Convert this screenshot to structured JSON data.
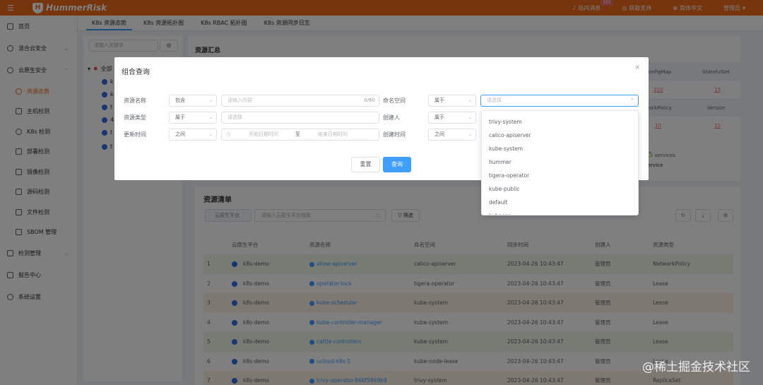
{
  "topbar": {
    "logo": "HummerRisk",
    "messages": "站内消息",
    "messages_badge": "155",
    "support": "获取支持",
    "language": "简体中文",
    "user": "管理员"
  },
  "sidebar": {
    "items": [
      {
        "label": "首页"
      },
      {
        "label": "混合云安全"
      },
      {
        "label": "云原生安全"
      }
    ],
    "subitems": [
      {
        "label": "资源态势"
      },
      {
        "label": "主机检测"
      },
      {
        "label": "K8s 检测"
      },
      {
        "label": "部署检测"
      },
      {
        "label": "镜像检测"
      },
      {
        "label": "源码检测"
      },
      {
        "label": "文件检测"
      },
      {
        "label": "SBOM 管理"
      }
    ],
    "bottom": [
      {
        "label": "检测管理"
      },
      {
        "label": "报告中心"
      },
      {
        "label": "系统设置"
      }
    ]
  },
  "tabs": [
    "K8s 资源态势",
    "K8s 资源拓扑图",
    "K8s RBAC 拓扑图",
    "K8s 资源同步日志"
  ],
  "tree": {
    "search_placeholder": "请输入关键字",
    "root": "全部",
    "nodes": [
      "k",
      "k",
      "t",
      "4",
      "t",
      "t"
    ]
  },
  "summary": {
    "title": "资源汇总",
    "headers": [
      "onfigMap",
      "StatefulSet",
      "tworkPolicy",
      "Version"
    ],
    "values": [
      "310",
      "15",
      "10",
      "10"
    ],
    "services_count": "5",
    "services_label": "services",
    "service_word": "ervice"
  },
  "list": {
    "title": "资源清单",
    "platform_filter": "云原生平台",
    "search_placeholder": "请输入云原生平台搜索",
    "filter_label": "筛选",
    "columns": [
      "",
      "云原生平台",
      "资源名称",
      "命名空间",
      "同步时间",
      "创建人",
      "资源类型"
    ],
    "rows": [
      {
        "idx": "1",
        "platform": "k8s-demo",
        "name": "allow-apiserver",
        "ns": "calico-apiserver",
        "time": "2023-04-26 10:43:47",
        "creator": "管理员",
        "type": "NetworkPolicy",
        "tone": "g"
      },
      {
        "idx": "2",
        "platform": "k8s-demo",
        "name": "operator-lock",
        "ns": "tigera-operator",
        "time": "2023-04-26 10:43:47",
        "creator": "管理员",
        "type": "Lease",
        "tone": ""
      },
      {
        "idx": "3",
        "platform": "k8s-demo",
        "name": "kube-scheduler",
        "ns": "kube-system",
        "time": "2023-04-26 10:43:47",
        "creator": "管理员",
        "type": "Lease",
        "tone": "o"
      },
      {
        "idx": "4",
        "platform": "k8s-demo",
        "name": "kube-controller-manager",
        "ns": "kube-system",
        "time": "2023-04-26 10:43:47",
        "creator": "管理员",
        "type": "Lease",
        "tone": ""
      },
      {
        "idx": "5",
        "platform": "k8s-demo",
        "name": "cattle-controllers",
        "ns": "kube-system",
        "time": "2023-04-26 10:43:47",
        "creator": "管理员",
        "type": "Lease",
        "tone": "g"
      },
      {
        "idx": "6",
        "platform": "k8s-demo",
        "name": "ucloud-k8s-1",
        "ns": "kube-node-lease",
        "time": "2023-04-26 10:43:47",
        "creator": "管理员",
        "type": "Lease",
        "tone": ""
      },
      {
        "idx": "7",
        "platform": "k8s-demo",
        "name": "trivy-operator-866f5869b9",
        "ns": "trivy-system",
        "time": "2023-04-26 10:43:47",
        "creator": "管理员",
        "type": "ReplicaSet",
        "tone": "o"
      }
    ]
  },
  "modal": {
    "title": "组合查询",
    "close": "×",
    "fields": {
      "resource_name_label": "资源名称",
      "resource_name_op": "包含",
      "resource_name_placeholder": "请输入内容",
      "resource_name_count": "0/60",
      "namespace_label": "命名空间",
      "namespace_op": "属于",
      "namespace_placeholder": "请选择",
      "resource_type_label": "资源类型",
      "resource_type_op": "属于",
      "resource_type_placeholder": "请选择",
      "creator_label": "创建人",
      "creator_op": "属于",
      "update_time_label": "更新时间",
      "update_time_op": "之间",
      "start_placeholder": "开始日期时间",
      "range_sep": "至",
      "end_placeholder": "结束日期时间",
      "create_time_label": "创建时间",
      "create_time_op": "之间"
    },
    "reset_label": "重置",
    "query_label": "查询"
  },
  "namespace_options": [
    "trivy-system",
    "calico-apiserver",
    "kube-system",
    "hummer",
    "tigera-operator",
    "kube-public",
    "default",
    "kubesgs"
  ],
  "watermark": "@稀土掘金技术社区"
}
